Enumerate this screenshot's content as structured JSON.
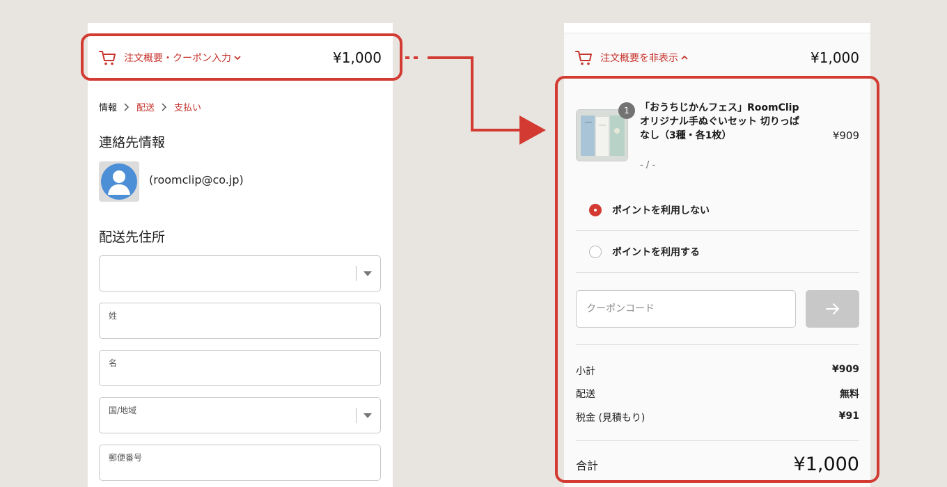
{
  "colors": {
    "accent": "#c6332c",
    "highlight": "#d23a32",
    "background": "#e8e5e1"
  },
  "left": {
    "summary": {
      "icon": "cart-icon",
      "label": "注文概要・クーポン入力",
      "chevron": "chevron-down-icon",
      "total": "¥1,000"
    },
    "breadcrumb": [
      {
        "label": "情報"
      },
      {
        "label": "配送"
      },
      {
        "label": "支払い"
      }
    ],
    "contact": {
      "title": "連絡先情報",
      "avatar": "user-avatar-icon",
      "email": "(roomclip@co.jp)"
    },
    "shipping": {
      "title": "配送先住所",
      "fields": [
        {
          "label": ""
        },
        {
          "label": "姓"
        },
        {
          "label": "名"
        },
        {
          "label": "国/地域"
        },
        {
          "label": "郵便番号"
        }
      ]
    }
  },
  "right": {
    "summary": {
      "icon": "cart-icon",
      "label": "注文概要を非表示",
      "chevron": "chevron-up-icon",
      "total": "¥1,000"
    },
    "product": {
      "quantity": "1",
      "name": "「おうちじかんフェス」RoomClipオリジナル手ぬぐいセット 切りっぱなし（3種・各1枚）",
      "variant": "- / -",
      "price": "¥909"
    },
    "points": [
      {
        "label": "ポイントを利用しない",
        "selected": true
      },
      {
        "label": "ポイントを利用する",
        "selected": false
      }
    ],
    "coupon": {
      "placeholder": "クーポンコード",
      "value": "",
      "button_icon": "arrow-right-icon"
    },
    "totals": {
      "subtotal_label": "小計",
      "subtotal": "¥909",
      "shipping_label": "配送",
      "shipping": "無料",
      "tax_label": "税金 (見積もり)",
      "tax": "¥91",
      "total_label": "合計",
      "total": "¥1,000"
    }
  }
}
